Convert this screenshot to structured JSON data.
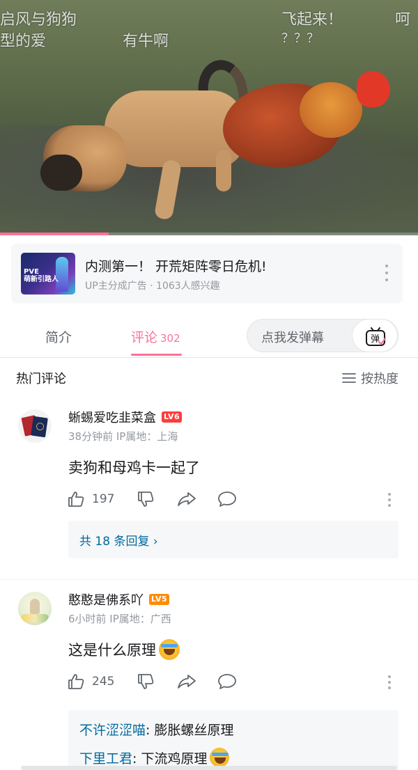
{
  "video": {
    "danmaku": [
      "启风与狗狗",
      "型的爱",
      "有牛啊",
      "飞起来！",
      "？？？",
      "呵"
    ],
    "progress": 0.26
  },
  "ad": {
    "thumb_text_line1": "PVE",
    "thumb_text_line2": "萌新引路人",
    "title": "内测第一！ 开荒矩阵零日危机!",
    "subtitle": "UP主分成广告 · 1063人感兴趣"
  },
  "tabs": {
    "intro": "简介",
    "comments": "评论",
    "comments_count": "302",
    "danmaku_placeholder": "点我发弹幕",
    "danmaku_button_glyph": "弹"
  },
  "hot_header": {
    "title": "热门评论",
    "sort_label": "按热度"
  },
  "comments": [
    {
      "username": "蜥蜴爱吃韭菜盒",
      "level": "LV6",
      "meta": "38分钟前 IP属地：上海",
      "text": "卖狗和母鸡卡一起了",
      "likes": "197",
      "replies_link": "共 18 条回复 ›"
    },
    {
      "username": "憨憨是佛系吖",
      "level": "LV5",
      "meta": "6小时前 IP属地：广西",
      "text": "这是什么原理",
      "likes": "245",
      "replies": [
        {
          "name": "不许涩涩喵",
          "text": ": 膨胀螺丝原理"
        },
        {
          "name": "下里工君",
          "text": ": 下流鸡原理"
        }
      ]
    }
  ],
  "colors": {
    "accent": "#fb7299",
    "link": "#00699d",
    "muted": "#9499a0",
    "lv6": "#ff3c3c",
    "lv5": "#ff8c00"
  },
  "icons": {
    "like": "thumb-up-icon",
    "dislike": "thumb-down-icon",
    "share": "share-icon",
    "reply": "reply-bubble-icon",
    "more": "more-vertical-icon",
    "sort": "list-icon",
    "danmaku": "tv-danmaku-icon"
  }
}
